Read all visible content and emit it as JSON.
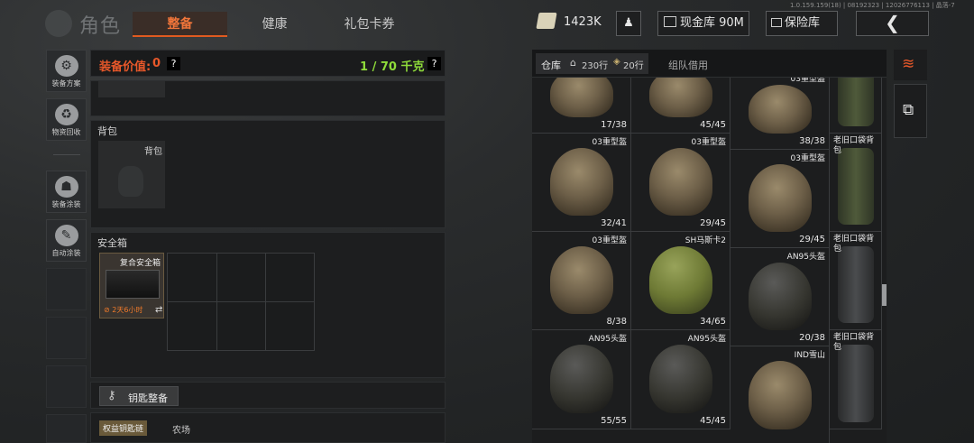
{
  "version": "1.0.159.159(18) | 08192323 | 12026776113 | 晶落-7",
  "header": {
    "title": "角色",
    "tabs": [
      {
        "label": "整备",
        "active": true
      },
      {
        "label": "健康"
      },
      {
        "label": "礼包卡券"
      }
    ],
    "money": "1423K",
    "cash_btn": "现金库 90M",
    "vault_btn": "保险库"
  },
  "sidebar": [
    {
      "label": "装备方案",
      "icon": "gear-set-icon"
    },
    {
      "label": "物资回收",
      "icon": "recycle-icon"
    },
    {
      "label": "装备涂装",
      "icon": "paint-icon"
    },
    {
      "label": "自动涂装",
      "icon": "auto-paint-icon"
    }
  ],
  "left": {
    "equip_value_label": "装备价值:",
    "equip_value": "0",
    "help": "?",
    "weight": "1 / 70 千克",
    "backpack_section": "背包",
    "backpack_slot": "背包",
    "safebox_section": "安全箱",
    "safebox_name": "复合安全箱",
    "safebox_timer": "2天6小时",
    "key_btn": "钥匙整备",
    "rights_label": "权益钥匙链",
    "farm": "农场"
  },
  "warehouse": {
    "tab": "仓库",
    "rows": "230行",
    "rows2": "20行",
    "team_tab": "组队借用"
  },
  "items": [
    {
      "name": "",
      "qty": "17/38",
      "type": "tan"
    },
    {
      "name": "",
      "qty": "45/45",
      "type": "tan"
    },
    {
      "name": "03重型盔",
      "qty": "38/38",
      "type": "tan"
    },
    {
      "name": "老旧口袋背包",
      "qty": "",
      "type": "bag"
    },
    {
      "name": "03重型盔",
      "qty": "32/41",
      "type": "tan"
    },
    {
      "name": "03重型盔",
      "qty": "29/45",
      "type": "tan"
    },
    {
      "name": "03重型盔",
      "qty": "29/45",
      "type": "tan"
    },
    {
      "name": "老旧口袋背包",
      "qty": "",
      "type": "bag"
    },
    {
      "name": "03重型盔",
      "qty": "8/38",
      "type": "tan"
    },
    {
      "name": "SH马斯卡2",
      "qty": "34/65",
      "type": "olive"
    },
    {
      "name": "AN95头盔",
      "qty": "20/38",
      "type": "dark"
    },
    {
      "name": "老旧口袋背包",
      "qty": "",
      "type": "bagdark"
    },
    {
      "name": "AN95头盔",
      "qty": "55/55",
      "type": "dark"
    },
    {
      "name": "AN95头盔",
      "qty": "45/45",
      "type": "dark"
    },
    {
      "name": "IND雪山",
      "qty": "",
      "type": "tan"
    },
    {
      "name": "老旧口袋背包",
      "qty": "",
      "type": "bagdark"
    }
  ]
}
